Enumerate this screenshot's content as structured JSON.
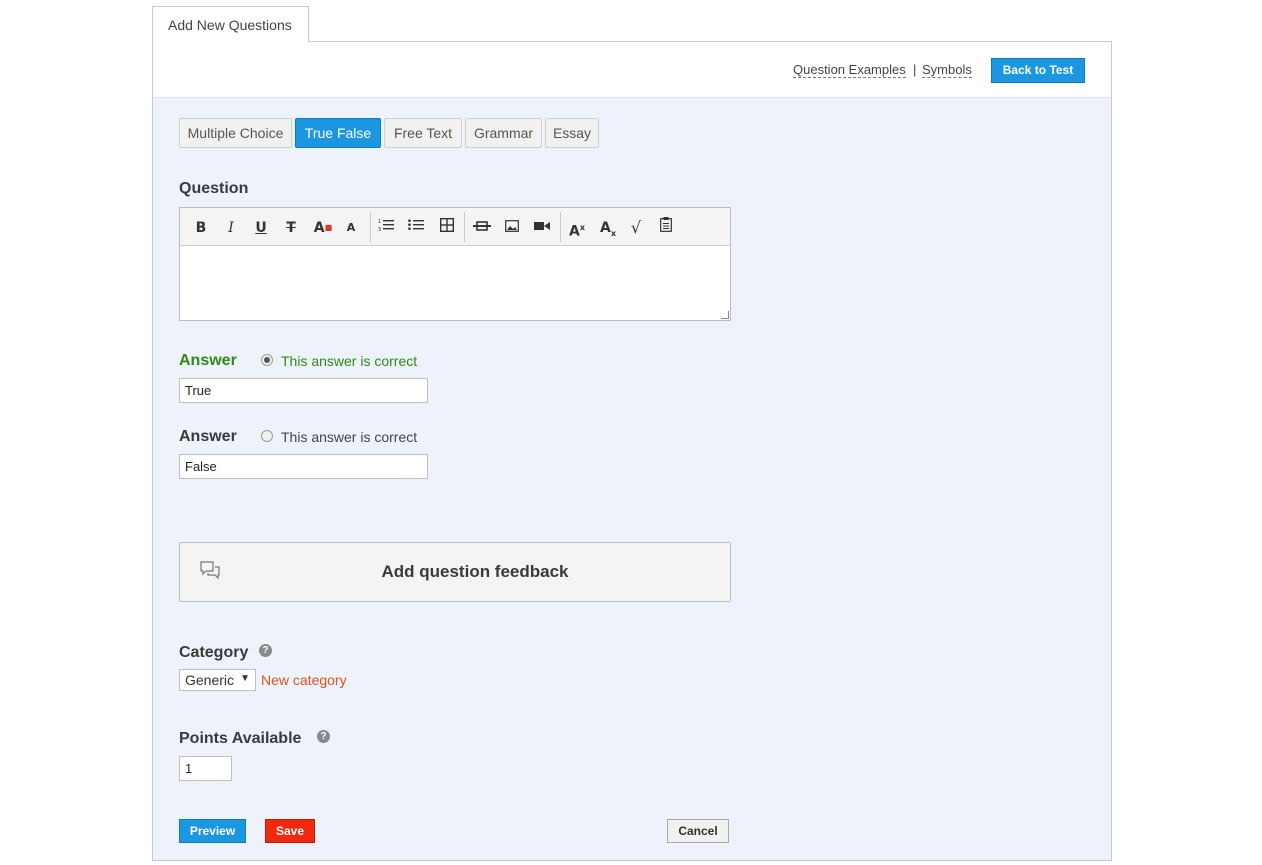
{
  "tab": {
    "label": "Add New Questions"
  },
  "header": {
    "question_examples": "Question Examples",
    "separator": "|",
    "symbols": "Symbols",
    "back_to_test": "Back to Test"
  },
  "question_types": [
    {
      "label": "Multiple Choice",
      "active": false
    },
    {
      "label": "True False",
      "active": true
    },
    {
      "label": "Free Text",
      "active": false
    },
    {
      "label": "Grammar",
      "active": false
    },
    {
      "label": "Essay",
      "active": false
    }
  ],
  "question": {
    "label": "Question",
    "toolbar": [
      "bold-icon",
      "italic-icon",
      "underline-icon",
      "strikethrough-icon",
      "font-color-icon",
      "font-size-icon",
      "ordered-list-icon",
      "unordered-list-icon",
      "table-icon",
      "horizontal-rule-icon",
      "image-icon",
      "video-icon",
      "superscript-icon",
      "subscript-icon",
      "math-icon",
      "paste-icon"
    ],
    "value": ""
  },
  "answers": [
    {
      "label": "Answer",
      "correct_label": "This answer is correct",
      "checked": true,
      "value": "True",
      "color": "#2e8b17"
    },
    {
      "label": "Answer",
      "correct_label": "This answer is correct",
      "checked": false,
      "value": "False",
      "color": "#444444"
    }
  ],
  "feedback": {
    "label": "Add question feedback"
  },
  "category": {
    "label": "Category",
    "selected": "Generic",
    "new_link": "New category"
  },
  "points": {
    "label": "Points Available",
    "value": "1"
  },
  "actions": {
    "preview": "Preview",
    "save": "Save",
    "cancel": "Cancel"
  },
  "colors": {
    "accent": "#1a97e0",
    "danger": "#f0290f",
    "correct": "#2e8b17",
    "link": "#d9541e",
    "panel_bg": "#eef2fa"
  }
}
